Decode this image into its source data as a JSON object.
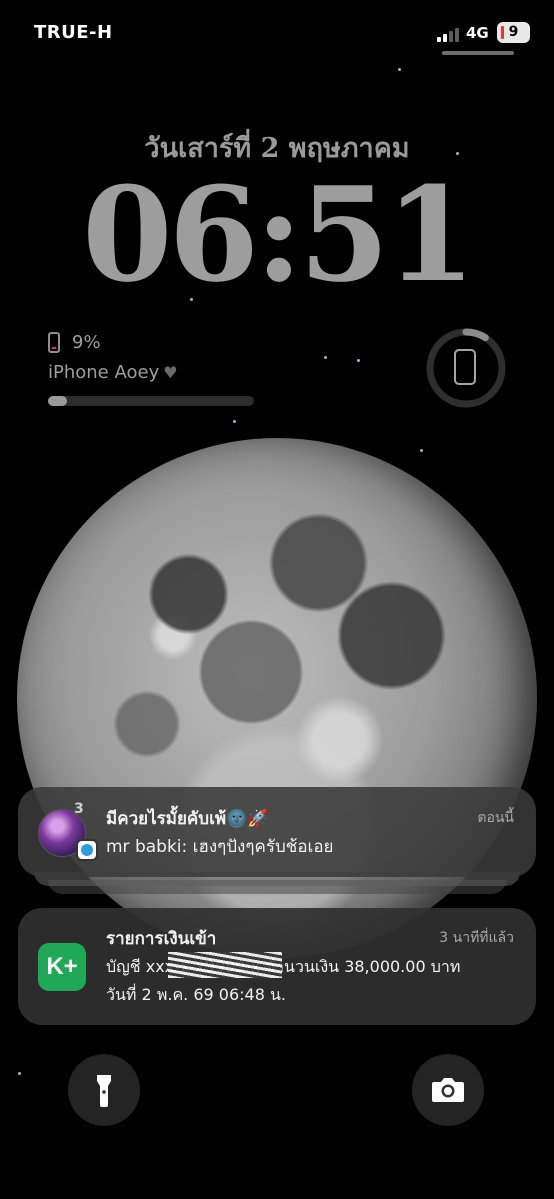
{
  "status_bar": {
    "carrier": "TRUE-H",
    "network": "4G",
    "battery_level": "9"
  },
  "lock_screen": {
    "date": "วันเสาร์ที่ 2 พฤษภาคม",
    "time": "06:51"
  },
  "battery_widget": {
    "percent_label": "9%",
    "device_name": "iPhone Aoey",
    "level": 0.09,
    "ring_progress": 0.09
  },
  "notifications": [
    {
      "app": "telegram",
      "stack_count": "3",
      "title": "มีควยไรมั้ยคับเพ้🌚🚀",
      "time": "ตอนนี้",
      "body": "mr babki: เฮงๆปังๆครับช้อเอย"
    },
    {
      "app": "K PLUS",
      "icon_text": "K+",
      "title": "รายการเงินเข้า",
      "time": "3 นาทีที่แล้ว",
      "line1": "บัญชี xxx-x-x9999-x  จำนวนเงิน 38,000.00 บาท",
      "line2": "วันที่ 2 พ.ค. 69  06:48 น."
    }
  ],
  "quick_actions": {
    "left": "flashlight-icon",
    "right": "camera-icon"
  },
  "colors": {
    "background": "#000000",
    "kplus_green": "#1fa855",
    "battery_low": "#d93a3a"
  }
}
